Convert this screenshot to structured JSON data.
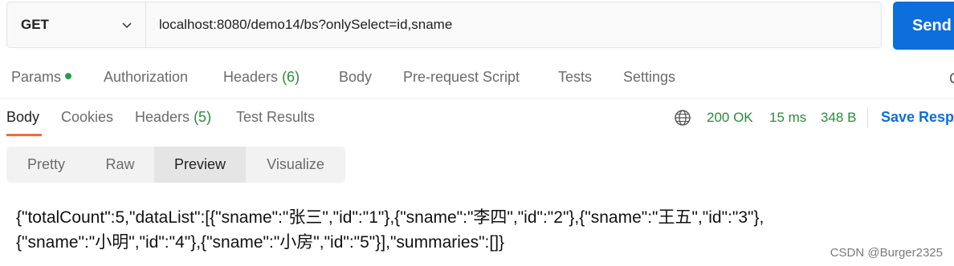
{
  "request": {
    "method": "GET",
    "url": "localhost:8080/demo14/bs?onlySelect=id,sname",
    "send_label": "Send"
  },
  "request_tabs": [
    {
      "label": "Params",
      "count": "",
      "dot": true
    },
    {
      "label": "Authorization",
      "count": ""
    },
    {
      "label": "Headers",
      "count": "(6)"
    },
    {
      "label": "Body",
      "count": ""
    },
    {
      "label": "Pre-request Script",
      "count": ""
    },
    {
      "label": "Tests",
      "count": ""
    },
    {
      "label": "Settings",
      "count": ""
    }
  ],
  "response_tabs": [
    {
      "label": "Body",
      "count": "",
      "active": true
    },
    {
      "label": "Cookies",
      "count": ""
    },
    {
      "label": "Headers",
      "count": "(5)"
    },
    {
      "label": "Test Results",
      "count": ""
    }
  ],
  "response_meta": {
    "status": "200 OK",
    "time": "15 ms",
    "size": "348 B",
    "save_label": "Save Response"
  },
  "view_modes": [
    {
      "label": "Pretty",
      "active": false
    },
    {
      "label": "Raw",
      "active": false
    },
    {
      "label": "Preview",
      "active": true
    },
    {
      "label": "Visualize",
      "active": false
    }
  ],
  "preview": {
    "line1": "{\"totalCount\":5,\"dataList\":[{\"sname\":\"张三\",\"id\":\"1\"},{\"sname\":\"李四\",\"id\":\"2\"},{\"sname\":\"王五\",\"id\":\"3\"},",
    "line2": "{\"sname\":\"小明\",\"id\":\"4\"},{\"sname\":\"小房\",\"id\":\"5\"}],\"summaries\":[]}"
  },
  "watermark": "CSDN @Burger2325",
  "colors": {
    "accent": "#0c6fdc",
    "status_green": "#2b8a3e",
    "tab_indicator": "#f26b3a"
  },
  "icons": {
    "method_dropdown": "chevron-down-icon",
    "network": "globe-icon"
  }
}
